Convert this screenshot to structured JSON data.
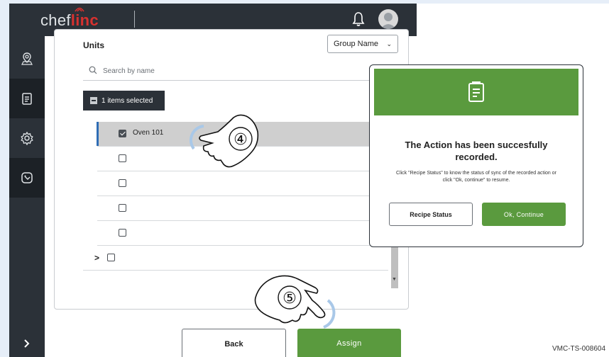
{
  "header": {
    "logo_prefix": "chef",
    "logo_brand": "linc"
  },
  "sidebar": {
    "items": [
      {
        "icon": "location-pin-icon"
      },
      {
        "icon": "clipboard-icon",
        "active": true
      },
      {
        "icon": "gear-icon"
      },
      {
        "icon": "tag-icon",
        "active": true
      },
      {
        "icon": "chevron-right-icon"
      }
    ]
  },
  "units": {
    "title": "Units",
    "group_select_value": "Group Name",
    "search_placeholder": "Search by name",
    "selected_chip": "1 items selected",
    "rows": [
      {
        "label": "Oven 101",
        "checked": true,
        "selected": true
      },
      {
        "label": "",
        "checked": false
      },
      {
        "label": "",
        "checked": false
      },
      {
        "label": "",
        "checked": false
      },
      {
        "label": "",
        "checked": false
      }
    ]
  },
  "footer": {
    "back_label": "Back",
    "assign_label": "Assign"
  },
  "modal": {
    "title": "The Action has been succesfully recorded.",
    "body": "Click \"Recipe Status\" to know the status of sync of the recorded action or click \"Ok, continue\" to resume.",
    "recipe_status_label": "Recipe Status",
    "ok_label": "Ok, Continue"
  },
  "annotations": {
    "step4": "④",
    "step5": "⑤"
  },
  "doc_id": "VMC-TS-008604",
  "colors": {
    "accent_green": "#5a9a3e",
    "dark_bar": "#2b3138",
    "brand_red": "#d6312f"
  }
}
